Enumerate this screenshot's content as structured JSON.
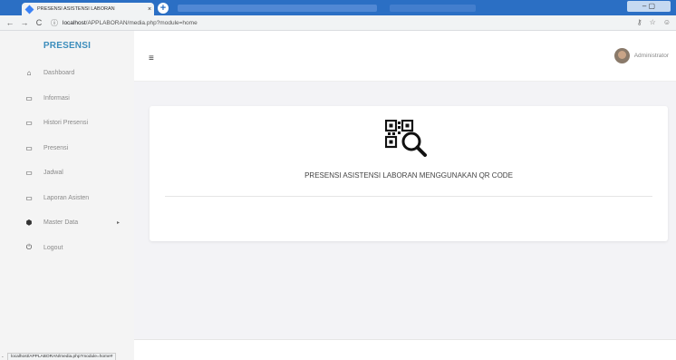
{
  "browser": {
    "tab_title": "PRESENSI ASISTENSI LABORAN",
    "tab_close": "×",
    "newtab_symbol": "+",
    "window_controls": "–  ▢",
    "url_host": "localhost",
    "url_path": "/APPLABORAN/media.php?module=home",
    "status_url": "localhost/APPLABORAN/media.php?module=home#",
    "back_symbol": "←",
    "forward_symbol": "→",
    "reload_symbol": "C",
    "info_symbol": "ⓘ",
    "key_symbol": "⚷",
    "star_symbol": "☆",
    "profile_symbol": "☺"
  },
  "sidebar": {
    "brand": "PRESENSI",
    "items": [
      {
        "label": "Dashboard",
        "icon": "home-icon",
        "glyph": "⌂"
      },
      {
        "label": "Informasi",
        "icon": "list-icon",
        "glyph": "▭"
      },
      {
        "label": "Histori Presensi",
        "icon": "list-icon",
        "glyph": "▭"
      },
      {
        "label": "Presensi",
        "icon": "list-icon",
        "glyph": "▭"
      },
      {
        "label": "Jadwal",
        "icon": "list-icon",
        "glyph": "▭"
      },
      {
        "label": "Laporan Asisten",
        "icon": "list-icon",
        "glyph": "▭"
      },
      {
        "label": "Master Data",
        "icon": "cube-icon",
        "glyph": "⬢",
        "arrow": "▸"
      },
      {
        "label": "Logout",
        "icon": "power-icon",
        "glyph": "⏻"
      }
    ]
  },
  "topnav": {
    "menu_symbol": "≡",
    "user_name": "Administrator"
  },
  "main": {
    "title": "PRESENSI ASISTENSI LABORAN MENGGUNAKAN QR CODE",
    "icon": "qr-scan-icon"
  },
  "colors": {
    "brand": "#3c8dbc",
    "browser_tabbar": "#2b6fc4",
    "sidebar_bg": "#f4f4f4",
    "content_bg": "#f3f3f6"
  }
}
